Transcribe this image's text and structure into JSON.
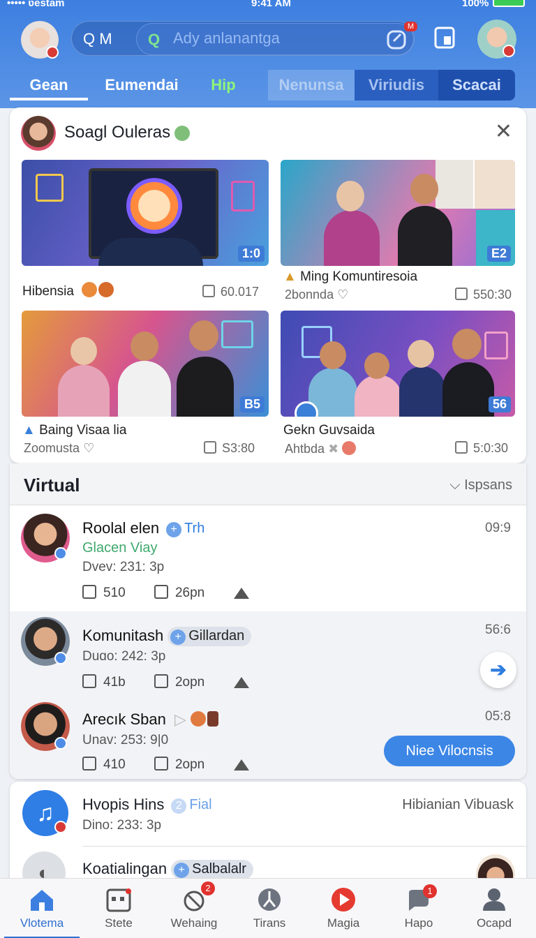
{
  "status_bar": {
    "carrier": "••••• ʋestam ",
    "time": "9:41 AM",
    "battery": "100%"
  },
  "header": {
    "search_left": "Q M",
    "search_placeholder": "Ady anlanantga",
    "notification_badge": "M",
    "tabs": [
      {
        "label": "Gean"
      },
      {
        "label": "Eumendai"
      },
      {
        "label": "Hip"
      },
      {
        "label": "Nenunsa"
      },
      {
        "label": "Viriudis"
      },
      {
        "label": "Scacai"
      }
    ]
  },
  "featured": {
    "title": "Soagl Ouleras",
    "items": [
      {
        "tag": "1:0",
        "title": "Hibensia",
        "sub": "",
        "stat": "60.017"
      },
      {
        "tag": "E2",
        "title": "Ming Komuntiresoia",
        "sub": "2bonnda",
        "stat": "550:30"
      },
      {
        "tag": "B5",
        "title": "Baing Visaa lia",
        "sub": "Zoomusta",
        "stat": "S3:80"
      },
      {
        "tag": "56",
        "title": "Gekn Guvsaida",
        "sub": "Ahtbda",
        "stat": "5:0:30"
      }
    ]
  },
  "virtual": {
    "title": "Virtual",
    "dropdown": "Ispsans",
    "rows": [
      {
        "name": "Roolal elen",
        "pill": "Trh",
        "green": "Glacen Viay",
        "sub": "Dvev: 231: 3p",
        "time": "09:9",
        "likes": "510",
        "comments": "26pn"
      },
      {
        "name": "Komunitash",
        "pill": "Gillardan",
        "sub": "Duɑo: 242: 3p",
        "time": "56:6",
        "likes": "41b",
        "comments": "2opn"
      },
      {
        "name": "Arecık Sban",
        "sub": "Unav: 253: 9|0",
        "time": "05:8",
        "likes": "410",
        "comments": "2opn"
      }
    ],
    "cta": "Niee Vilocnsis"
  },
  "panel3": {
    "title": "Hvopis Hins",
    "pill": "Fial",
    "sub": "Dino: 233: 3p",
    "right": "Hibianian Vibuask",
    "row2_title": "Koatialingan",
    "row2_pill": "Salbalalr"
  },
  "bottom_nav": [
    {
      "label": "Vlotema",
      "icon": "home-icon"
    },
    {
      "label": "Stete",
      "icon": "calendar-icon"
    },
    {
      "label": "Wehaing",
      "icon": "wrench-icon",
      "badge": "2"
    },
    {
      "label": "Tirans",
      "icon": "compass-icon"
    },
    {
      "label": "Magia",
      "icon": "play-icon"
    },
    {
      "label": "Hapo",
      "icon": "chat-icon",
      "badge": "1"
    },
    {
      "label": "Ocapd",
      "icon": "profile-icon"
    }
  ],
  "colors": {
    "accent": "#3d7fe0",
    "cta": "#3c86e6",
    "green": "#3fa96d",
    "badge": "#e0322e"
  }
}
